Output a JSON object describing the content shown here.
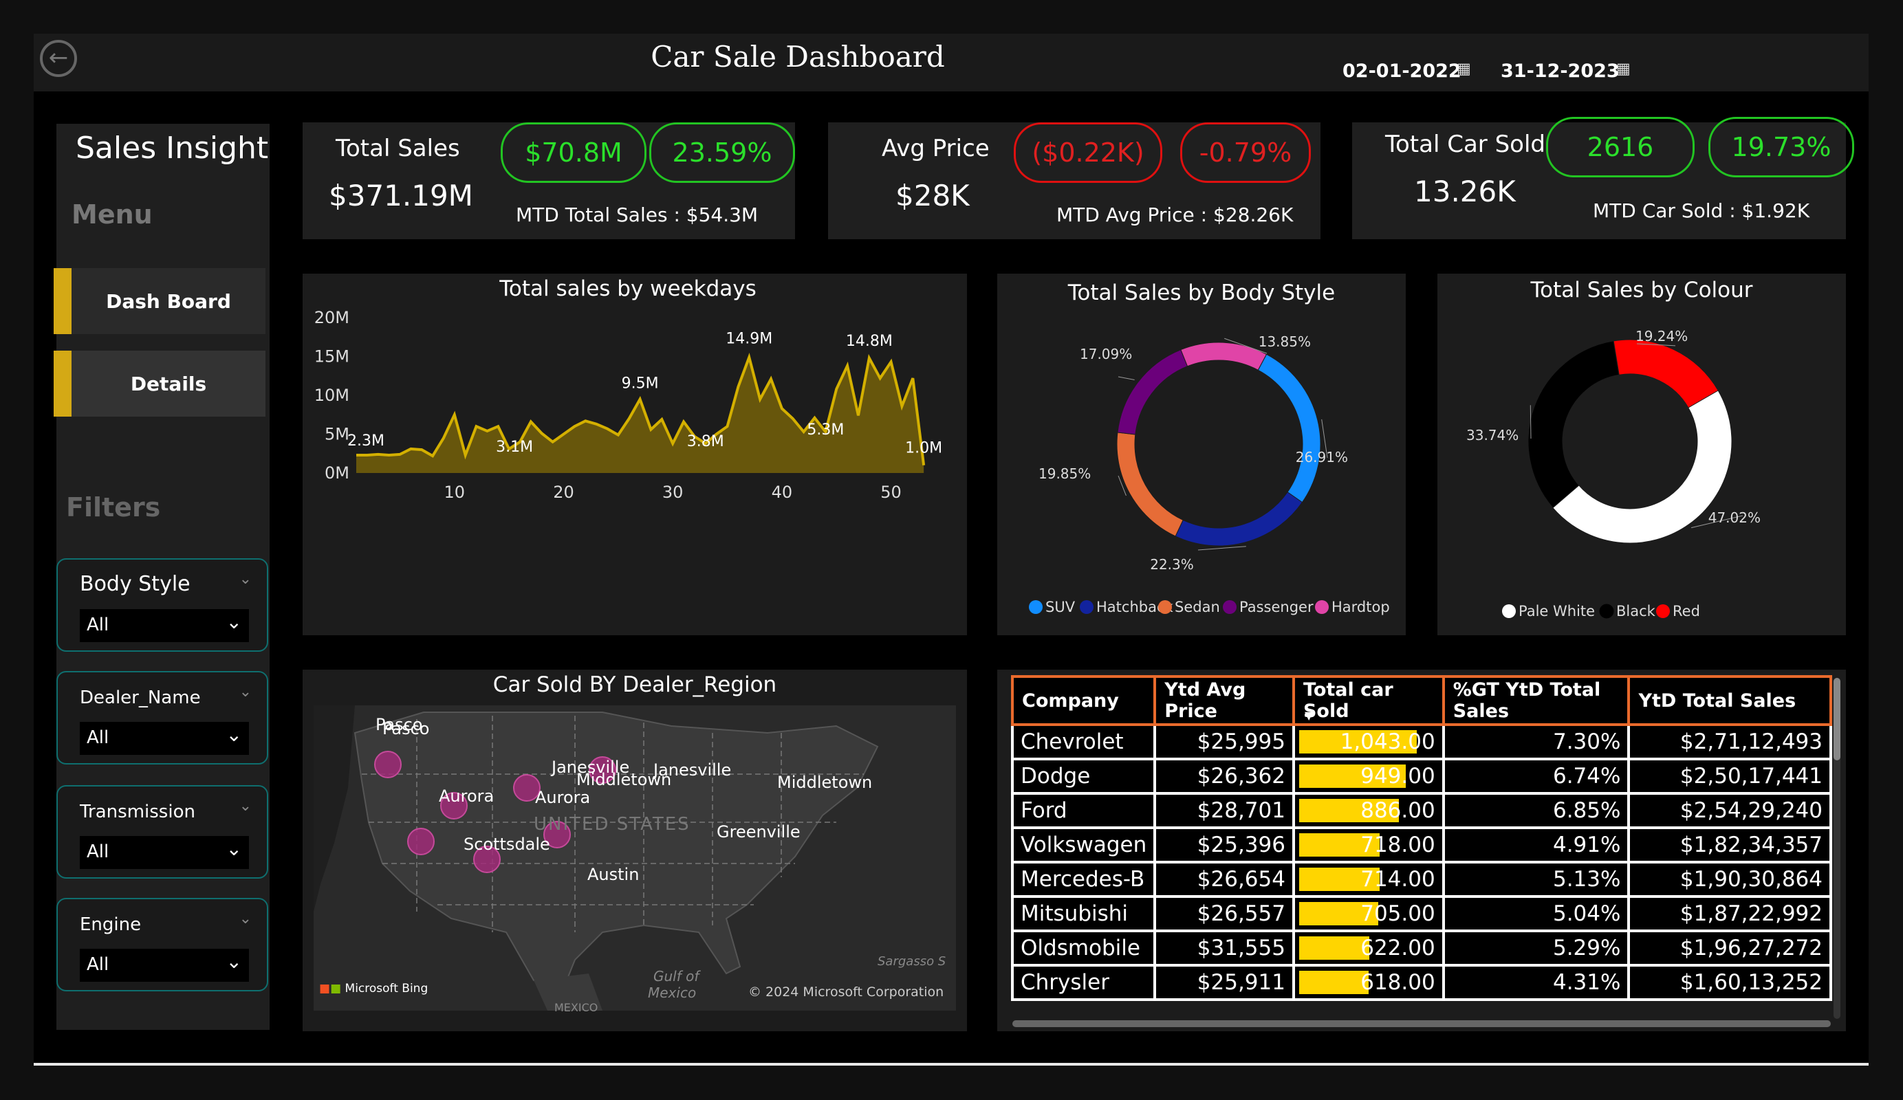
{
  "header": {
    "title": "Car Sale Dashboard",
    "start_date": "02-01-2022",
    "end_date": "31-12-2023",
    "back_icon": "back-arrow-icon",
    "calendar_icon": "calendar-icon"
  },
  "sidebar": {
    "title": "Sales Insight",
    "menu_label": "Menu",
    "nav": [
      {
        "label": "Dash Board"
      },
      {
        "label": "Details"
      }
    ],
    "filters_label": "Filters",
    "slicers": [
      {
        "label": "Body Style",
        "value": "All"
      },
      {
        "label": "Dealer_Name",
        "value": "All"
      },
      {
        "label": "Transmission",
        "value": "All"
      },
      {
        "label": "Engine",
        "value": "All"
      }
    ],
    "accent_color": "#d4a915"
  },
  "kpis": [
    {
      "label": "Total Sales",
      "value": "$371.19M",
      "delta_value": "$70.8M",
      "delta_pct": "23.59%",
      "mtd": "MTD Total Sales : $54.3M",
      "status": "positive"
    },
    {
      "label": "Avg Price",
      "value": "$28K",
      "delta_value": "($0.22K)",
      "delta_pct": "-0.79%",
      "mtd": "MTD Avg Price : $28.26K",
      "status": "negative"
    },
    {
      "label": "Total Car Sold",
      "value": "13.26K",
      "delta_value": "2616",
      "delta_pct": "19.73%",
      "mtd": "MTD Car Sold : $1.92K",
      "status": "positive"
    }
  ],
  "weekday_chart": {
    "title": "Total sales by weekdays",
    "y_ticks": [
      "20M",
      "15M",
      "10M",
      "5M",
      "0M"
    ],
    "x_ticks": [
      "10",
      "20",
      "30",
      "40",
      "50"
    ],
    "labels": [
      "2.3M",
      "3.1M",
      "9.5M",
      "3.8M",
      "14.9M",
      "5.3M",
      "14.8M",
      "1.0M"
    ]
  },
  "body_style_chart": {
    "title": "Total Sales by Body Style",
    "pct_labels": [
      "26.91%",
      "22.3%",
      "19.85%",
      "17.09%",
      "13.85%"
    ],
    "legend": [
      "SUV",
      "Hatchback",
      "Sedan",
      "Passenger",
      "Hardtop"
    ]
  },
  "colour_chart": {
    "title": "Total Sales by Colour",
    "pct_labels": [
      "47.02%",
      "33.74%",
      "19.24%"
    ],
    "legend": [
      "Pale White",
      "Black",
      "Red"
    ]
  },
  "map": {
    "title": "Car Sold BY Dealer_Region",
    "cities": [
      "Pasco",
      "Aurora",
      "Janesville",
      "Middletown",
      "Scottsdale",
      "Greenville",
      "Austin"
    ],
    "country_label": "UNITED STATES",
    "gulf_label_1": "Gulf of",
    "gulf_label_2": "Mexico",
    "sea_label": "Sargasso S",
    "mexico_label": "MEXICO",
    "bing_label": "Microsoft Bing",
    "copyright": "© 2024 Microsoft Corporation"
  },
  "table": {
    "columns": [
      "Company",
      "Ytd Avg Price",
      "Total car Sold",
      "%GT YtD Total Sales",
      "YtD Total Sales"
    ],
    "sort_icon": "sort-desc-icon",
    "rows": [
      {
        "company": "Chevrolet",
        "avg_price": "$25,995",
        "sold": "1,043.00",
        "sold_num": 1043,
        "pct": "7.30%",
        "total": "$2,71,12,493"
      },
      {
        "company": "Dodge",
        "avg_price": "$26,362",
        "sold": "949.00",
        "sold_num": 949,
        "pct": "6.74%",
        "total": "$2,50,17,441"
      },
      {
        "company": "Ford",
        "avg_price": "$28,701",
        "sold": "886.00",
        "sold_num": 886,
        "pct": "6.85%",
        "total": "$2,54,29,240"
      },
      {
        "company": "Volkswagen",
        "avg_price": "$25,396",
        "sold": "718.00",
        "sold_num": 718,
        "pct": "4.91%",
        "total": "$1,82,34,357"
      },
      {
        "company": "Mercedes-B",
        "avg_price": "$26,654",
        "sold": "714.00",
        "sold_num": 714,
        "pct": "5.13%",
        "total": "$1,90,30,864"
      },
      {
        "company": "Mitsubishi",
        "avg_price": "$26,557",
        "sold": "705.00",
        "sold_num": 705,
        "pct": "5.04%",
        "total": "$1,87,22,992"
      },
      {
        "company": "Oldsmobile",
        "avg_price": "$31,555",
        "sold": "622.00",
        "sold_num": 622,
        "pct": "5.29%",
        "total": "$1,96,27,272"
      },
      {
        "company": "Chrysler",
        "avg_price": "$25,911",
        "sold": "618.00",
        "sold_num": 618,
        "pct": "4.31%",
        "total": "$1,60,13,252"
      }
    ]
  },
  "chart_data": [
    {
      "type": "area",
      "title": "Total sales by weekdays",
      "xlabel": "",
      "ylabel": "",
      "ylim": [
        0,
        20000000
      ],
      "x": [
        1,
        2,
        3,
        4,
        5,
        6,
        7,
        8,
        9,
        10,
        11,
        12,
        13,
        14,
        15,
        16,
        17,
        18,
        19,
        20,
        21,
        22,
        23,
        24,
        25,
        26,
        27,
        28,
        29,
        30,
        31,
        32,
        33,
        34,
        35,
        36,
        37,
        38,
        39,
        40,
        41,
        42,
        43,
        44,
        45,
        46,
        47,
        48,
        49,
        50,
        51,
        52,
        53
      ],
      "series": [
        {
          "values": [
            2300000,
            2300000,
            2400000,
            2300000,
            2400000,
            3100000,
            3000000,
            2200000,
            4500000,
            7500000,
            2300000,
            6000000,
            5400000,
            6000000,
            3100000,
            4000000,
            6600000,
            5100000,
            4000000,
            5000000,
            6000000,
            6700000,
            6300000,
            5700000,
            4900000,
            7000000,
            9500000,
            5600000,
            6900000,
            3800000,
            6600000,
            4700000,
            3800000,
            5000000,
            6000000,
            11100000,
            14900000,
            9500000,
            12100000,
            8300000,
            7000000,
            5300000,
            7100000,
            5300000,
            10800000,
            13800000,
            7400000,
            14800000,
            12200000,
            14300000,
            8600000,
            12200000,
            1000000
          ]
        }
      ],
      "annotations": [
        {
          "x": 1,
          "label": "2.3M"
        },
        {
          "x": 15,
          "label": "3.1M"
        },
        {
          "x": 27,
          "label": "9.5M"
        },
        {
          "x": 33,
          "label": "3.8M"
        },
        {
          "x": 37,
          "label": "14.9M"
        },
        {
          "x": 44,
          "label": "5.3M"
        },
        {
          "x": 48,
          "label": "14.8M"
        },
        {
          "x": 53,
          "label": "1.0M"
        }
      ],
      "color": "#d4b000"
    },
    {
      "type": "pie",
      "title": "Total Sales by Body Style",
      "categories": [
        "SUV",
        "Hatchback",
        "Sedan",
        "Passenger",
        "Hardtop"
      ],
      "values": [
        26.91,
        22.3,
        19.85,
        17.09,
        13.85
      ],
      "colors": [
        "#118dff",
        "#12239e",
        "#e66c37",
        "#6b007b",
        "#e044a7"
      ],
      "legend": "bottom"
    },
    {
      "type": "pie",
      "title": "Total Sales by Colour",
      "categories": [
        "Pale White",
        "Black",
        "Red"
      ],
      "values": [
        47.02,
        33.74,
        19.24
      ],
      "colors": [
        "#ffffff",
        "#000000",
        "#ff0000"
      ],
      "legend": "bottom"
    }
  ]
}
